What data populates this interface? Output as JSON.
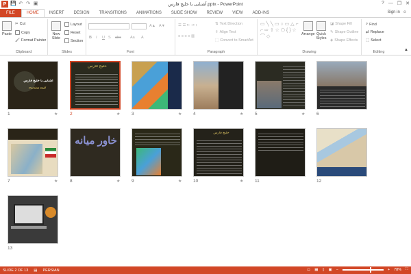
{
  "window": {
    "title": "آشنایی با خلیج فارس.pptx - PowerPoint",
    "minimize": "—",
    "restore": "❐",
    "close": "✕",
    "help": "?"
  },
  "qat": {
    "logo": "P",
    "save": "💾",
    "undo": "↶",
    "redo": "↷",
    "present": "▣"
  },
  "tabs": [
    "FILE",
    "HOME",
    "INSERT",
    "DESIGN",
    "TRANSITIONS",
    "ANIMATIONS",
    "SLIDE SHOW",
    "REVIEW",
    "VIEW",
    "ADD-INS"
  ],
  "signin": "Sign in",
  "ribbon": {
    "clipboard": {
      "label": "Clipboard",
      "paste": "Paste",
      "cut": "Cut",
      "copy": "Copy",
      "format_painter": "Format Painter"
    },
    "slides": {
      "label": "Slides",
      "new_slide": "New Slide",
      "layout": "Layout",
      "reset": "Reset",
      "section": "Section"
    },
    "font": {
      "label": "Font",
      "b": "B",
      "i": "I",
      "u": "U",
      "s": "S",
      "abc": "abc",
      "aa": "Aa",
      "a": "A"
    },
    "paragraph": {
      "label": "Paragraph",
      "text_direction": "Text Direction",
      "align_text": "Align Text",
      "convert": "Convert to SmartArt"
    },
    "drawing": {
      "label": "Drawing",
      "arrange": "Arrange",
      "quick_styles": "Quick Styles",
      "shape_fill": "Shape Fill",
      "shape_outline": "Shape Outline",
      "shape_effects": "Shape Effects"
    },
    "editing": {
      "label": "Editing",
      "find": "Find",
      "replace": "Replace",
      "select": "Select"
    }
  },
  "slides": [
    {
      "num": "1",
      "star": "★",
      "title": "آشنایی با خلیج فارس",
      "subtitle": "Persian Gulf",
      "bg": "#2a2418"
    },
    {
      "num": "2",
      "star": "★",
      "heading": "خلیج فارس",
      "bg": "#2a2a1e",
      "selected": true
    },
    {
      "num": "3",
      "star": "★",
      "bg": "#1a3a6a"
    },
    {
      "num": "4",
      "star": "★",
      "bg": "#6a8fb0"
    },
    {
      "num": "5",
      "star": "★",
      "bg": "#2b2b22"
    },
    {
      "num": "6",
      "star": "",
      "bg": "#2a2a2a"
    },
    {
      "num": "7",
      "star": "★",
      "bg": "#e8dcc0"
    },
    {
      "num": "8",
      "star": "★",
      "heading": "خاور میانه",
      "bg": "#2f2a20"
    },
    {
      "num": "9",
      "star": "★",
      "bg": "#2a2818"
    },
    {
      "num": "10",
      "star": "★",
      "heading": "خلیج فارس",
      "bg": "#24221a"
    },
    {
      "num": "11",
      "star": "",
      "bg": "#1f1d16"
    },
    {
      "num": "12",
      "star": "",
      "bg": "#dcd6c4"
    },
    {
      "num": "13",
      "star": "",
      "bg": "#3a3a3a"
    }
  ],
  "status": {
    "slide": "SLIDE 2 OF 13",
    "language": "PERSIAN",
    "zoom": "78%",
    "zoom_minus": "−",
    "zoom_plus": "+"
  },
  "colors": {
    "accent": "#d24726"
  }
}
